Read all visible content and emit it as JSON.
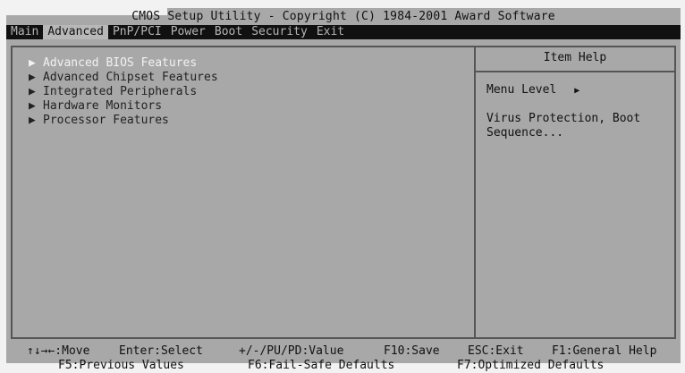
{
  "header": {
    "title": "CMOS Setup Utility - Copyright (C) 1984-2001 Award Software"
  },
  "menubar": {
    "items": [
      {
        "label": "Main",
        "active": false
      },
      {
        "label": "Advanced",
        "active": true
      },
      {
        "label": "PnP/PCI",
        "active": false
      },
      {
        "label": "Power",
        "active": false
      },
      {
        "label": "Boot",
        "active": false
      },
      {
        "label": "Security",
        "active": false
      },
      {
        "label": "Exit",
        "active": false
      }
    ]
  },
  "menu": {
    "items": [
      {
        "label": "Advanced BIOS Features",
        "selected": true
      },
      {
        "label": "Advanced Chipset Features",
        "selected": false
      },
      {
        "label": "Integrated Peripherals",
        "selected": false
      },
      {
        "label": "Hardware Monitors",
        "selected": false
      },
      {
        "label": "Processor Features",
        "selected": false
      }
    ]
  },
  "help": {
    "header": "Item Help",
    "menu_level_label": "Menu Level",
    "menu_level_icon": "triangle-right-icon",
    "description": "Virus Protection, Boot Sequence..."
  },
  "footer": {
    "row1": [
      "↑↓→←:Move",
      "Enter:Select",
      "+/-/PU/PD:Value",
      "F10:Save",
      "ESC:Exit",
      "F1:General Help"
    ],
    "row2": [
      "F5:Previous Values",
      "F6:Fail-Safe Defaults",
      "F7:Optimized Defaults"
    ]
  },
  "colors": {
    "background": "#a8a8a8",
    "menubar": "#111111",
    "highlight_text": "#f2f2f2"
  }
}
